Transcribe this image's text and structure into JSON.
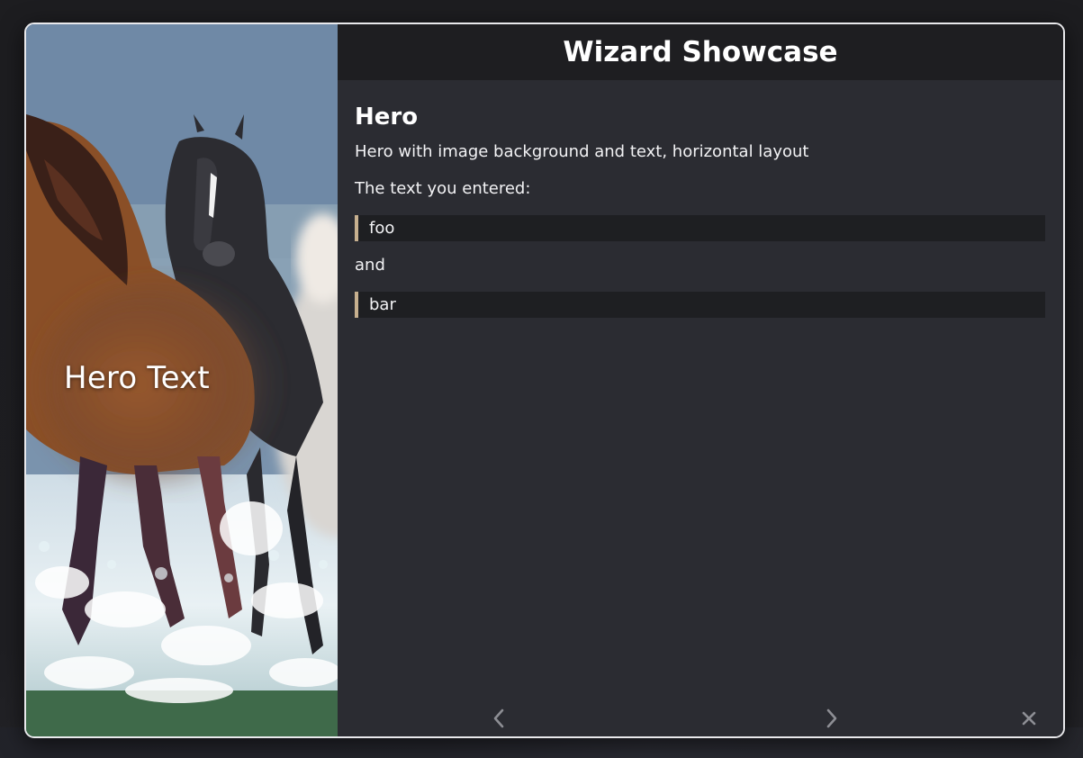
{
  "dialog": {
    "title": "Wizard Showcase",
    "hero": {
      "text": "Hero Text",
      "image": "running-horses-in-water"
    },
    "content": {
      "heading": "Hero",
      "description": "Hero with image background and text, horizontal layout",
      "entered_label": "The text you entered:",
      "first_value": "foo",
      "connector": "and",
      "second_value": "bar"
    },
    "nav": {
      "prev_icon": "chevron-left-icon",
      "next_icon": "chevron-right-icon",
      "close_icon": "close-icon"
    }
  },
  "colors": {
    "accent": "#c7b08f",
    "title_bar": "#1e1e21",
    "panel": "#2b2c32",
    "value_box": "#1e1f22"
  }
}
